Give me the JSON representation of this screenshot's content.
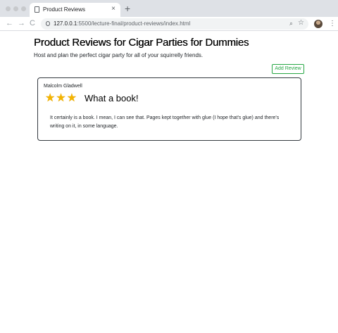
{
  "browser": {
    "tab_title": "Product Reviews",
    "tab_close": "×",
    "new_tab": "+",
    "back": "←",
    "forward": "→",
    "reload": "C",
    "url_host": "127.0.0.1",
    "url_path": ":5500/lecture-final/product-reviews/index.html",
    "zoom_icon": "⌕",
    "bookmark_icon": "☆",
    "menu_icon": "⋮"
  },
  "page": {
    "title": "Product Reviews for Cigar Parties for Dummies",
    "subtitle": "Host and plan the perfect cigar party for all of your squirrelly friends.",
    "add_review_label": "Add Review"
  },
  "reviews": [
    {
      "author": "Malcolm Gladwell",
      "rating": 3,
      "star_glyph": "★",
      "title": "What a book!",
      "body": "It certainly is a book. I mean, I can see that. Pages kept together with glue (I hope that's glue) and there's writing on it, in some language."
    }
  ],
  "colors": {
    "accent_green": "#28a745",
    "star_gold": "#f4b400"
  }
}
